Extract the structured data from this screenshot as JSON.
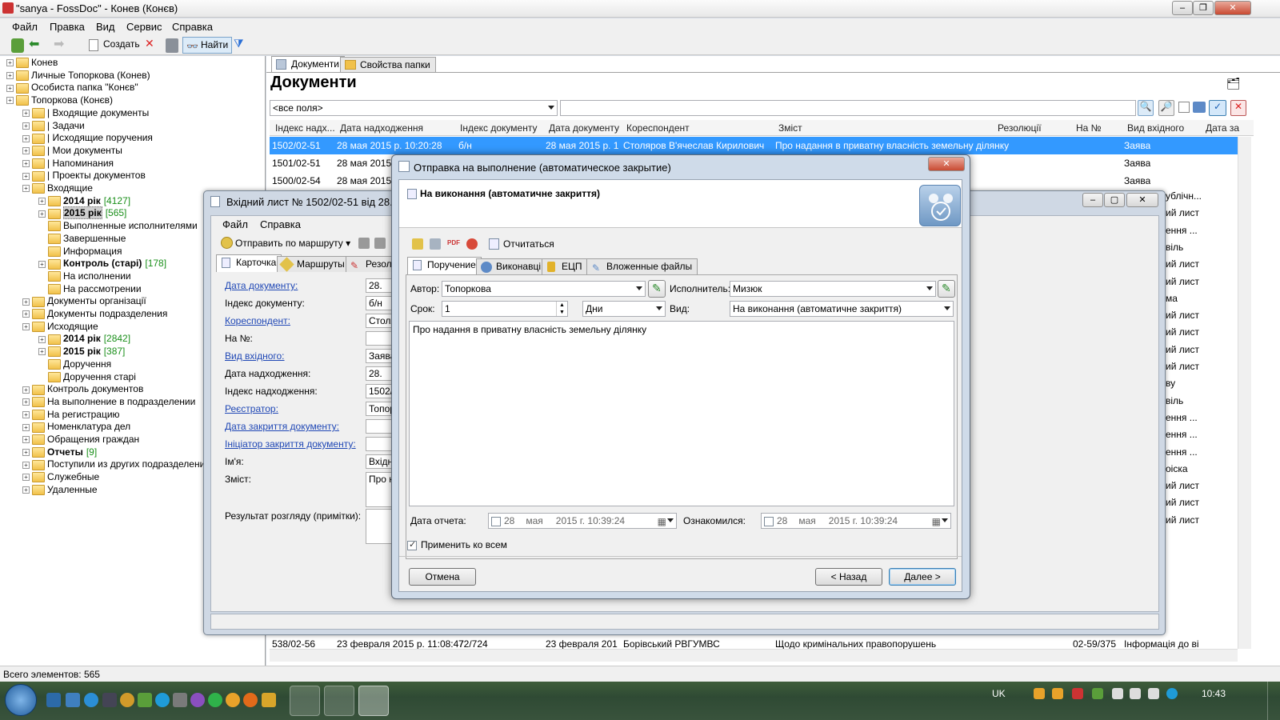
{
  "window": {
    "title": "\"sanya - FossDoc\" - Конев (Конєв)"
  },
  "menu": [
    "Файл",
    "Правка",
    "Вид",
    "Сервис",
    "Справка"
  ],
  "toolbar": {
    "create": "Создать",
    "find": "Найти"
  },
  "tree": [
    {
      "label": "Конев",
      "level": 0
    },
    {
      "label": "Личные Топоркова (Конев)",
      "level": 0
    },
    {
      "label": "Особиста папка \"Конєв\"",
      "level": 0
    },
    {
      "label": "Топоркова (Конєв)",
      "level": 0
    },
    {
      "label": "| Входящие документы",
      "level": 1
    },
    {
      "label": "| Задачи",
      "level": 1
    },
    {
      "label": "| Исходящие поручения",
      "level": 1
    },
    {
      "label": "| Мои документы",
      "level": 1
    },
    {
      "label": "| Напоминания",
      "level": 1
    },
    {
      "label": "| Проекты документов",
      "level": 1
    },
    {
      "label": "Входящие",
      "level": 1
    },
    {
      "label": "2014 рік",
      "count": "[4127]",
      "level": 2,
      "bold": true
    },
    {
      "label": "2015 рік",
      "count": "[565]",
      "level": 2,
      "bold": true,
      "selected": true
    },
    {
      "label": "Выполненные исполнителями",
      "level": 2
    },
    {
      "label": "Завершенные",
      "level": 2
    },
    {
      "label": "Информация",
      "level": 2
    },
    {
      "label": "Контроль (старі)",
      "count": "[178]",
      "level": 2,
      "bold": true
    },
    {
      "label": "На исполнении",
      "level": 2
    },
    {
      "label": "На рассмотрении",
      "level": 2
    },
    {
      "label": "Документы організації",
      "level": 1
    },
    {
      "label": "Документы подразделения",
      "level": 1
    },
    {
      "label": "Исходящие",
      "level": 1
    },
    {
      "label": "2014 рік",
      "count": "[2842]",
      "level": 2,
      "bold": true
    },
    {
      "label": "2015 рік",
      "count": "[387]",
      "level": 2,
      "bold": true
    },
    {
      "label": "Доручення",
      "level": 2
    },
    {
      "label": "Доручення старі",
      "level": 2
    },
    {
      "label": "Контроль документов",
      "level": 1
    },
    {
      "label": "На выполнение в подразделении",
      "level": 1
    },
    {
      "label": "На регистрацию",
      "level": 1
    },
    {
      "label": "Номенклатура дел",
      "level": 1
    },
    {
      "label": "Обращения граждан",
      "level": 1
    },
    {
      "label": "Отчеты",
      "count": "[9]",
      "level": 1,
      "bold": true
    },
    {
      "label": "Поступили из других подразделений",
      "level": 1
    },
    {
      "label": "Служебные",
      "level": 1
    },
    {
      "label": "Удаленные",
      "level": 1
    }
  ],
  "right": {
    "tabs": [
      "Документи",
      "Свойства папки"
    ],
    "title": "Документи",
    "filter": "<все поля>",
    "columns": [
      "Індекс надх...",
      "Дата надходження",
      "Індекс документу",
      "Дата документу",
      "Кореспондент",
      "Зміст",
      "Резолюції",
      "На №",
      "Вид вхідного",
      "Дата за"
    ],
    "rows": [
      [
        "1502/02-51",
        "28 мая 2015 р. 10:20:28",
        "б/н",
        "28 мая 2015 р. 1...",
        "Столяров В'ячеслав Кирилович",
        "Про надання в приватну власність земельну ділянку",
        "",
        "",
        "Заява"
      ],
      [
        "1501/02-51",
        "28 мая 2015 р.",
        "",
        "",
        "",
        "",
        "",
        "",
        "Заява"
      ],
      [
        "1500/02-54",
        "28 мая 2015 р.",
        "",
        "",
        "",
        "",
        "",
        "",
        "Заява"
      ],
      [
        "538/02-56",
        "23 февраля 2015 р. 11:08:47",
        "72/724",
        "23 февраля 201",
        "Борівський РВГУМВС",
        "Щодо кримінальних правопорушень",
        "",
        "02-59/375",
        "Інформація до ві"
      ]
    ],
    "side_values": [
      "ублічн...",
      "ий лист",
      "ення ...",
      "віль",
      "ий лист",
      "ий лист",
      "ма",
      "ий лист",
      "ий лист",
      "ий лист",
      "ий лист",
      "ву",
      "віль",
      "ення ...",
      "ення ...",
      "ення ...",
      "оіска",
      "ий лист",
      "ий лист",
      "ий лист"
    ]
  },
  "docwin": {
    "title": "Вхідний лист № 1502/02-51 від 28.05.2",
    "menu": [
      "Файл",
      "Справка"
    ],
    "send_route": "Отправить по маршруту",
    "tabs": [
      "Карточка",
      "Маршруты",
      "Резол"
    ],
    "fields": [
      {
        "label": "Дата документу:",
        "link": true,
        "value": "28."
      },
      {
        "label": "Індекс документу:",
        "link": false,
        "value": "б/н"
      },
      {
        "label": "Кореспондент:",
        "link": true,
        "value": "Столя"
      },
      {
        "label": "На №:",
        "link": false,
        "value": ""
      },
      {
        "label": "Вид вхідного:",
        "link": true,
        "value": "Заява"
      },
      {
        "label": "Дата надходження:",
        "link": false,
        "value": "28."
      },
      {
        "label": "Індекс надходження:",
        "link": false,
        "value": "1502/"
      },
      {
        "label": "Реєстратор:",
        "link": true,
        "value": "Топор"
      },
      {
        "label": "Дата закриття документу:",
        "link": true,
        "value": ""
      },
      {
        "label": "Ініціатор закриття документу:",
        "link": true,
        "value": ""
      },
      {
        "label": "Ім'я:",
        "link": false,
        "value": "Вхідни"
      },
      {
        "label": "Зміст:",
        "link": false,
        "value": "Про на"
      },
      {
        "label": "Результат розгляду (примітки):",
        "link": false,
        "value": ""
      }
    ]
  },
  "dialog": {
    "title": "Отправка на выполнение (автоматическое закрытие)",
    "subtitle": "На виконання (автоматичне закриття)",
    "report_btn": "Отчитаться",
    "tabs": [
      "Поручение",
      "Виконавці",
      "ЕЦП",
      "Вложенные файлы"
    ],
    "author_label": "Автор:",
    "author": "Топоркова",
    "executor_label": "Исполнитель:",
    "executor": "Мизюк",
    "term_label": "Срок:",
    "term": "1",
    "term_unit": "Дни",
    "kind_label": "Вид:",
    "kind": "На виконання (автоматичне закриття)",
    "content": "Про надання в приватну власність земельну ділянку",
    "report_date_label": "Дата отчета:",
    "report_date": [
      "28",
      "мая",
      "2015 г. 10:39:24"
    ],
    "acquainted_label": "Ознакомился:",
    "acquainted_date": [
      "28",
      "мая",
      "2015 г. 10:39:24"
    ],
    "apply_all": "Применить ко всем",
    "cancel": "Отмена",
    "back": "< Назад",
    "next": "Далее >"
  },
  "status": "Всего элементов: 565",
  "taskbar": {
    "lang": "UK",
    "clock": "10:43"
  }
}
